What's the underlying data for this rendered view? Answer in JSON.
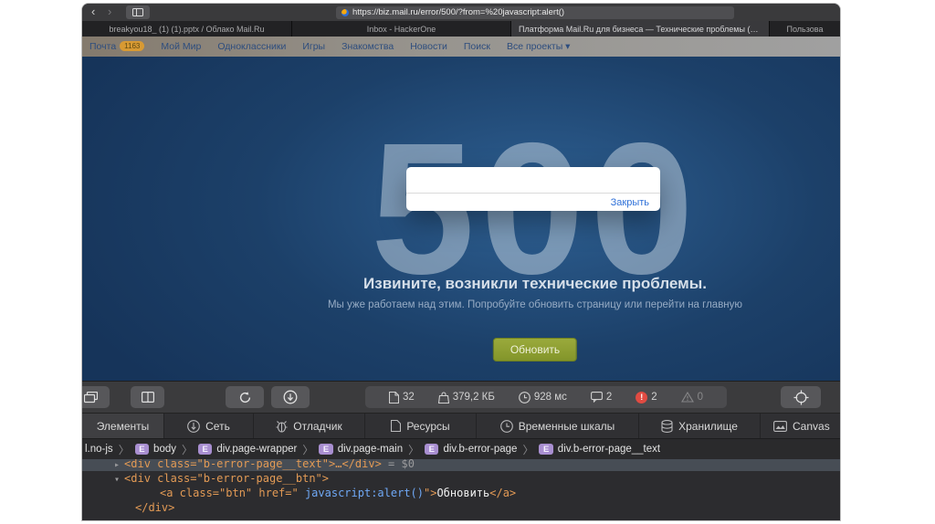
{
  "browser": {
    "back": "‹",
    "forward": "›",
    "url": "https://biz.mail.ru/error/500/?from=%20javascript:alert()",
    "tabs": [
      {
        "title": "breakyou18_ (1) (1).pptx / Облако Mail.Ru"
      },
      {
        "title": "Inbox - HackerOne"
      },
      {
        "title": "Платформа Mail.Ru для бизнеса — Технические проблемы (ошиб…"
      },
      {
        "title": "Пользова"
      }
    ]
  },
  "mailru": {
    "badge": "1163",
    "items": [
      "Почта",
      "Мой Мир",
      "Одноклассники",
      "Игры",
      "Знакомства",
      "Новости",
      "Поиск",
      "Все проекты ▾"
    ]
  },
  "error_page": {
    "code": "500",
    "title": "Извините, возникли технические проблемы.",
    "subtitle": "Мы уже работаем над этим. Попробуйте обновить страницу или перейти на главную",
    "refresh_label": "Обновить",
    "dialog_close": "Закрыть",
    "accent_button_color": "#8a9b2e",
    "page_color": "#1c4069"
  },
  "devtools": {
    "stats": {
      "resources": "32",
      "transfer_size": "379,2 КБ",
      "load_time": "928 мс",
      "logs": "2",
      "errors": "2",
      "error_mark": "!",
      "warnings": "0"
    },
    "tabs": [
      {
        "label": "Элементы"
      },
      {
        "label": "Сеть"
      },
      {
        "label": "Отладчик"
      },
      {
        "label": "Ресурсы"
      },
      {
        "label": "Временные шкалы"
      },
      {
        "label": "Хранилище"
      },
      {
        "label": "Canvas"
      }
    ],
    "breadcrumb": {
      "badge": "E",
      "root": "l.no-js",
      "items": [
        "body",
        "div.page-wrapper",
        "div.page-main",
        "div.b-error-page",
        "div.b-error-page__text"
      ]
    },
    "code": {
      "l1_tri": "▸",
      "l1_tag": "<div class=\"b-error-page__text\">…</div>",
      "l1_eq": " = $0",
      "l2_tri": "▾",
      "l2_tag": "<div class=\"b-error-page__btn\">",
      "l3_a": "<a class=\"btn\" href=\" ",
      "l3_js": "javascript:alert()",
      "l3_close": "\">",
      "l3_text": "Обновить",
      "l3_end": "</a>",
      "l4": "</div>"
    }
  }
}
